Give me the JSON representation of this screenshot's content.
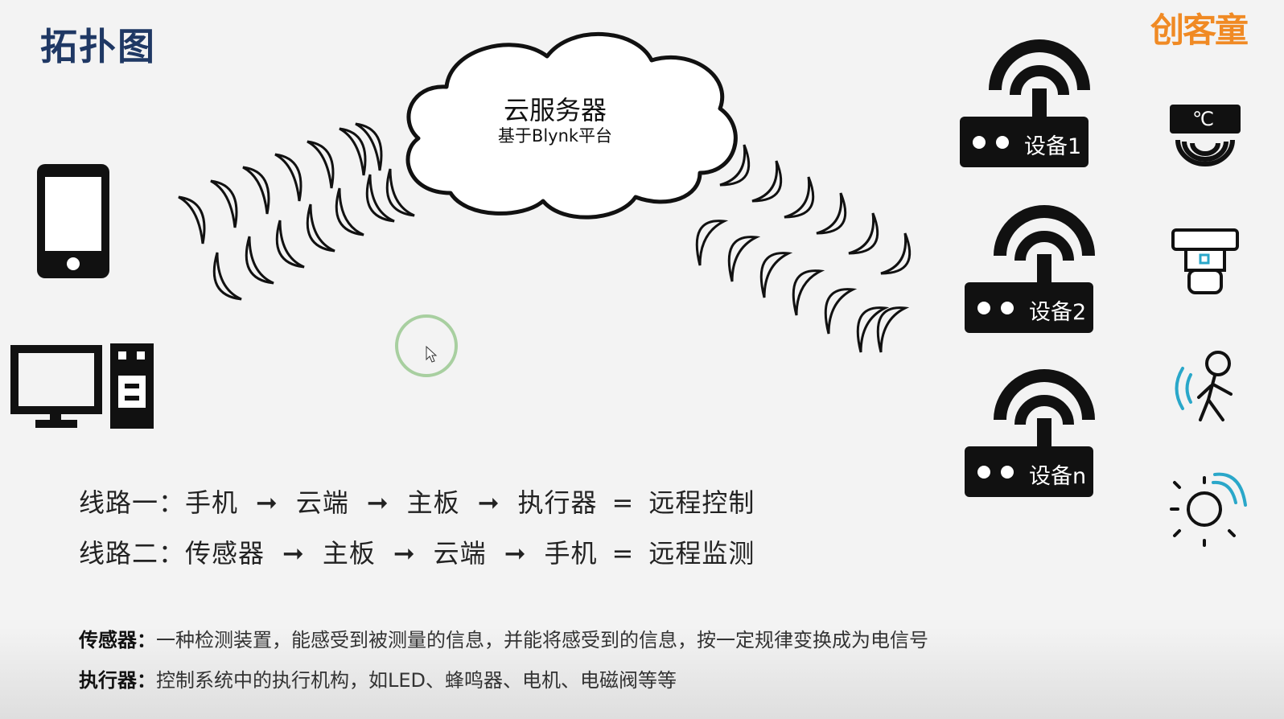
{
  "slide": {
    "title": "拓扑图",
    "logo_text": "创客童"
  },
  "cloud": {
    "title": "云服务器",
    "subtitle": "基于Blynk平台"
  },
  "devices": [
    {
      "label": "设备1"
    },
    {
      "label": "设备2"
    },
    {
      "label": "设备n"
    }
  ],
  "sensors": [
    {
      "icon": "temperature-sensor-icon",
      "label": "℃"
    },
    {
      "icon": "smoke-detector-icon"
    },
    {
      "icon": "motion-sensor-icon"
    },
    {
      "icon": "light-sensor-icon"
    }
  ],
  "routes": [
    {
      "label": "线路一：",
      "steps": [
        "手机",
        "云端",
        "主板",
        "执行器"
      ],
      "arrow": "➞",
      "equals": "=",
      "result": "远程控制"
    },
    {
      "label": "线路二：",
      "steps": [
        "传感器",
        "主板",
        "云端",
        "手机"
      ],
      "arrow": "➞",
      "equals": "=",
      "result": "远程监测"
    }
  ],
  "definitions": [
    {
      "term": "传感器：",
      "text": "一种检测装置，能感受到被测量的信息，并能将感受到的信息，按一定规律变换成为电信号"
    },
    {
      "term": "执行器：",
      "text": "控制系统中的执行机构，如LED、蜂鸣器、电机、电磁阀等等"
    }
  ],
  "colors": {
    "title": "#1f3864",
    "icon": "#111111",
    "sensor_accent": "#2aa7c9",
    "logo": "#f08a24",
    "cursor_ring": "#a8cfa0"
  }
}
